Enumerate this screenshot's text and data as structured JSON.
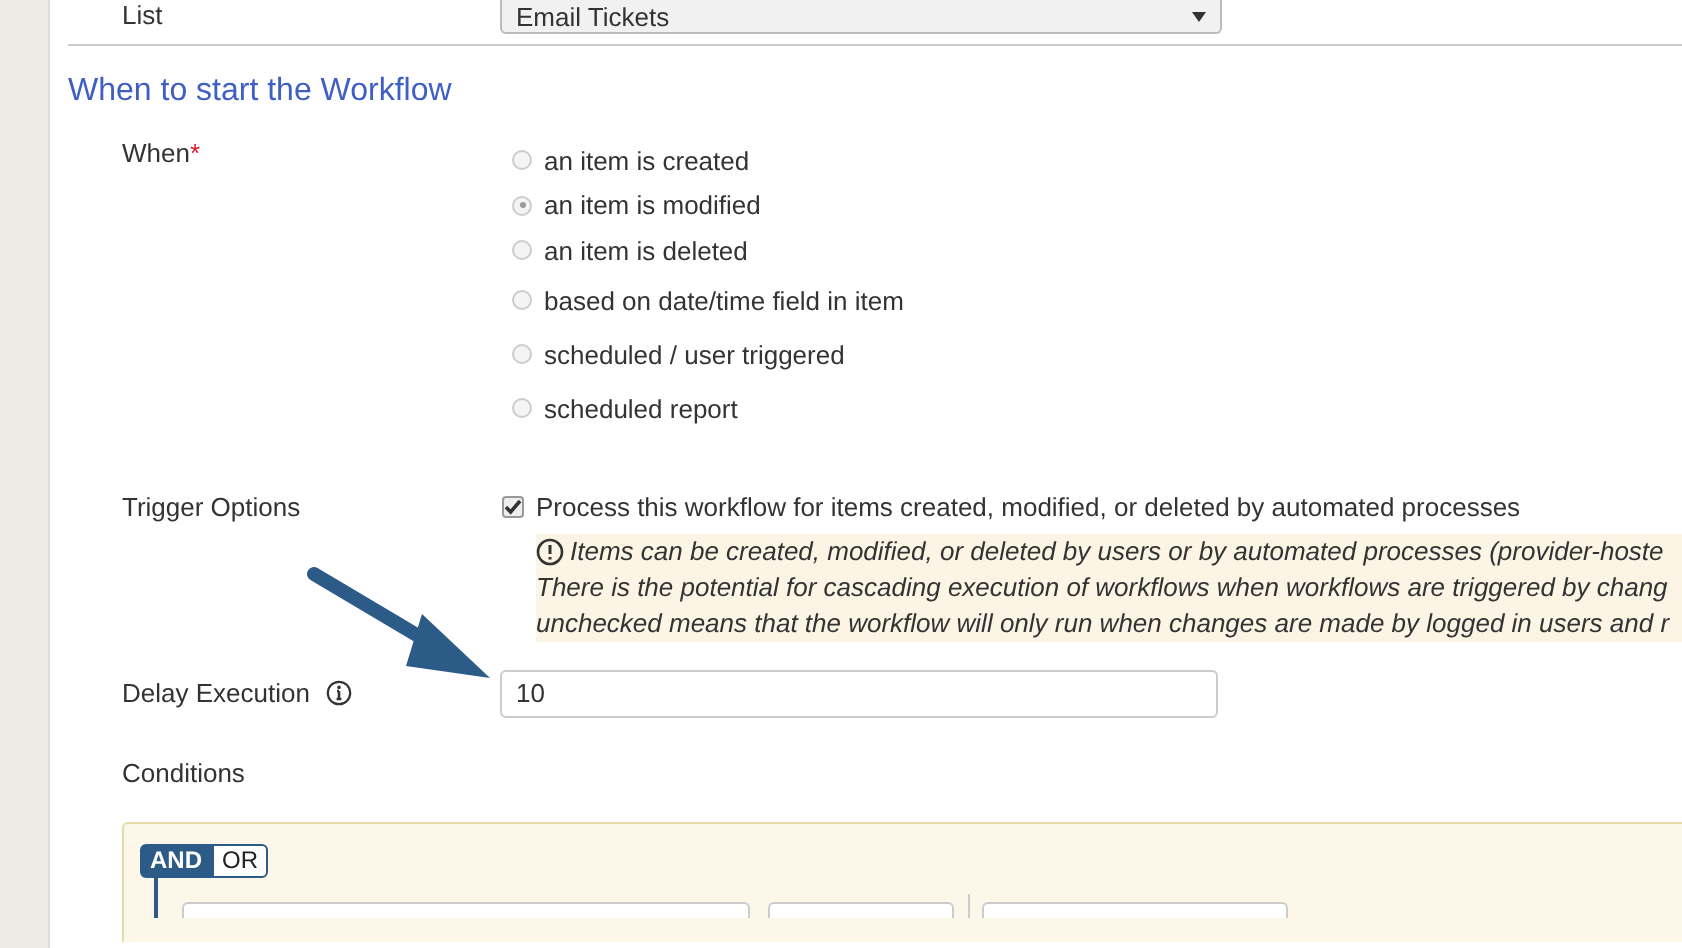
{
  "list_field": {
    "label": "List",
    "value": "Email Tickets"
  },
  "section_title": "When to start the Workflow",
  "when": {
    "label": "When",
    "required_mark": "*",
    "options": [
      {
        "label": "an item is created",
        "selected": false
      },
      {
        "label": "an item is modified",
        "selected": true
      },
      {
        "label": "an item is deleted",
        "selected": false
      },
      {
        "label": "based on date/time field in item",
        "selected": false
      },
      {
        "label": "scheduled / user triggered",
        "selected": false
      },
      {
        "label": "scheduled report",
        "selected": false
      }
    ]
  },
  "trigger_options": {
    "label": "Trigger Options",
    "checkbox_label": "Process this workflow for items created, modified, or deleted by automated processes",
    "checked": true,
    "note_lines": [
      "Items can be created, modified, or deleted by users or by automated processes (provider-hoste",
      "There is the potential for cascading execution of workflows when workflows are triggered by chang",
      "unchecked means that the workflow will only run when changes are made by logged in users and r"
    ]
  },
  "delay_execution": {
    "label": "Delay Execution",
    "value": "10"
  },
  "conditions": {
    "label": "Conditions",
    "operators": [
      {
        "label": "AND",
        "selected": true
      },
      {
        "label": "OR",
        "selected": false
      }
    ]
  }
}
